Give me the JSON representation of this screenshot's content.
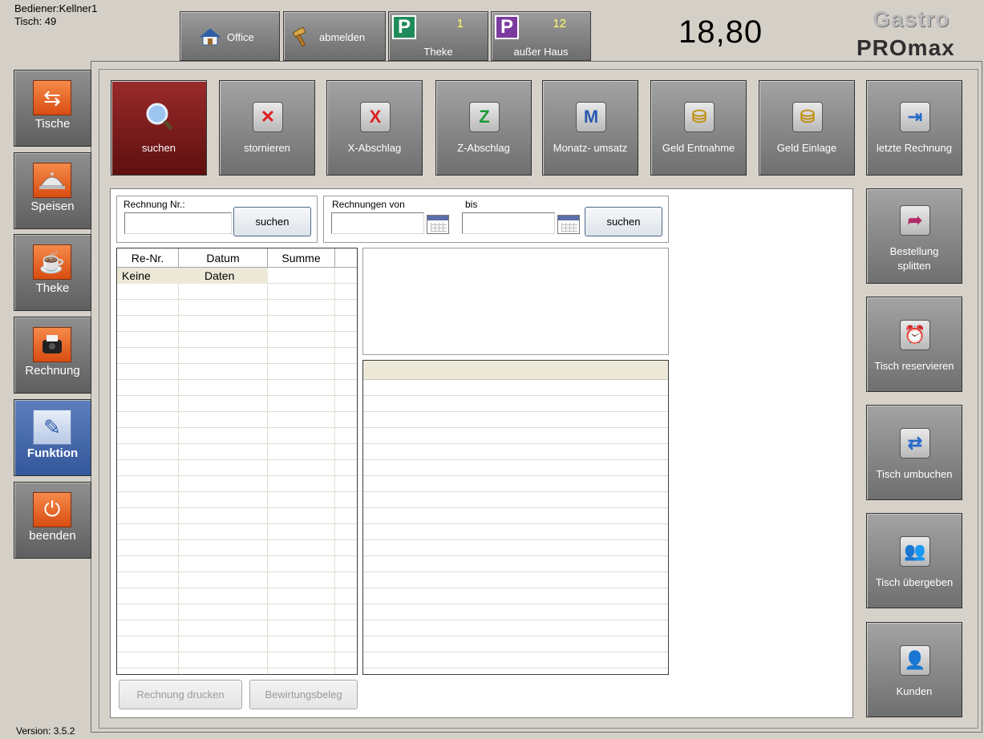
{
  "header": {
    "operator": "Bediener:Kellner1",
    "table": "Tisch: 49",
    "office_label": "Office",
    "logout_label": "abmelden",
    "counter_count": "1",
    "counter_label": "Theke",
    "takeaway_count": "12",
    "takeaway_label": "außer Haus",
    "total": "18,80",
    "logo_line1": "Gastro",
    "logo_line2": "PROmax"
  },
  "nav": {
    "items": [
      {
        "label": "Tische",
        "icon": "swap-arrows-icon"
      },
      {
        "label": "Speisen",
        "icon": "cloche-icon"
      },
      {
        "label": "Theke",
        "icon": "cup-icon"
      },
      {
        "label": "Rechnung",
        "icon": "receipt-printer-icon"
      },
      {
        "label": "Funktion",
        "icon": "form-icon"
      },
      {
        "label": "beenden",
        "icon": "power-icon"
      }
    ],
    "active": "Funktion"
  },
  "toolbar": {
    "items": [
      {
        "label": "suchen",
        "icon": "magnifier-icon"
      },
      {
        "label": "stornieren",
        "icon": "cancel-receipt-icon"
      },
      {
        "label": "X-Abschlag",
        "icon": "x-report-icon"
      },
      {
        "label": "Z-Abschlag",
        "icon": "z-report-icon"
      },
      {
        "label": "Monatz- umsatz",
        "icon": "m-report-icon"
      },
      {
        "label": "Geld Entnahme",
        "icon": "coins-out-icon"
      },
      {
        "label": "Geld Einlage",
        "icon": "coins-in-icon"
      },
      {
        "label": "letzte Rechnung",
        "icon": "last-arrow-icon"
      }
    ],
    "selected": "suchen"
  },
  "right": {
    "split_line1": "Bestellung",
    "split_line2": "splitten",
    "reserve": "Tisch reservieren",
    "rebook": "Tisch umbuchen",
    "transfer": "Tisch übergeben",
    "customers": "Kunden"
  },
  "search": {
    "invoice_no_label": "Rechnung Nr.:",
    "invoice_no_value": "",
    "search_label": "suchen",
    "from_label": "Rechnungen von",
    "to_label": "bis",
    "from_value": "",
    "to_value": "",
    "range_search_label": "suchen"
  },
  "invoice_table": {
    "columns": [
      "Re-Nr.",
      "Datum",
      "Summe"
    ],
    "rows": [
      [
        "Keine",
        "Daten",
        ""
      ]
    ]
  },
  "footer": {
    "print_label": "Rechnung drucken",
    "entertain_label": "Bewirtungsbeleg",
    "version": "Version: 3.5.2"
  }
}
